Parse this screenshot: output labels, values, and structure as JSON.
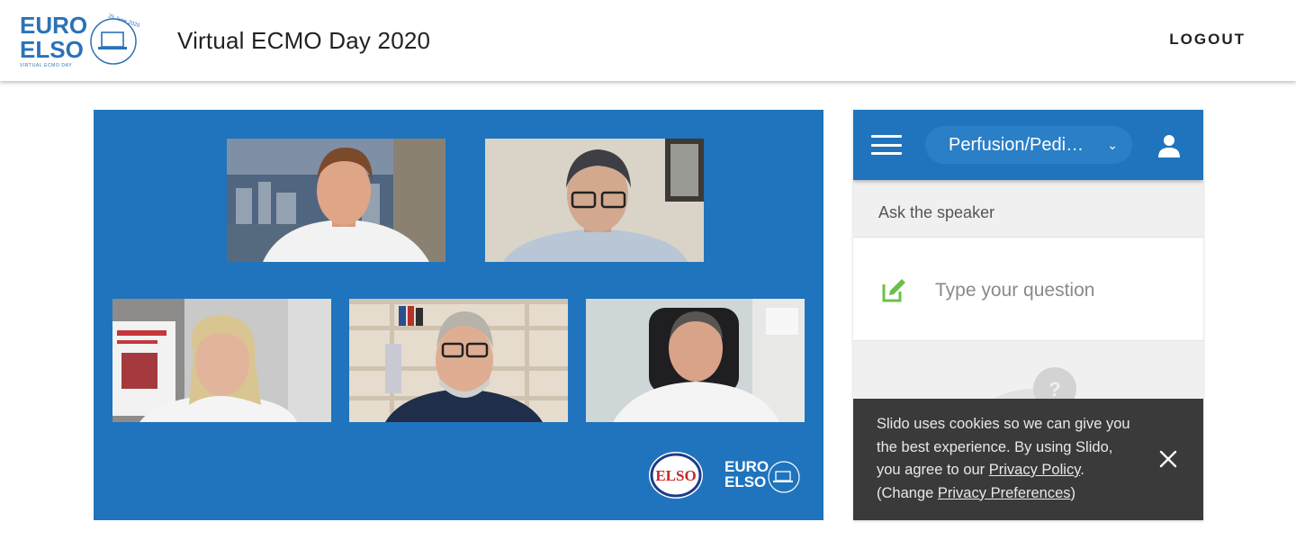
{
  "header": {
    "logo_text_top": "EURO",
    "logo_text_bottom": "ELSO",
    "logo_date": "25 June 2020",
    "logo_sub": "VIRTUAL ECMO DAY",
    "title": "Virtual ECMO Day 2020",
    "logout_label": "LOGOUT"
  },
  "stage": {
    "background": "#1f74bd",
    "participants": [
      {
        "name": "participant-1",
        "shirt": "#f2f2f2",
        "bg": "#5d6f86"
      },
      {
        "name": "participant-2",
        "shirt": "#b9c6d6",
        "bg": "#d9d3c8"
      },
      {
        "name": "participant-3",
        "shirt": "#f4f4f4",
        "bg": "#c9c9c9"
      },
      {
        "name": "participant-4",
        "shirt": "#1f2e4a",
        "bg": "#e6dccd"
      },
      {
        "name": "participant-5",
        "shirt": "#f4f4f4",
        "bg": "#cfd6d8"
      }
    ],
    "footer_logo_1": "ELSO",
    "footer_logo_2_top": "EURO",
    "footer_logo_2_bottom": "ELSO"
  },
  "slido": {
    "room_label": "Perfusion/Pedi…",
    "ask_label": "Ask the speaker",
    "question_placeholder": "Type your question",
    "cookie": {
      "text_1": "Slido uses cookies so we can give you the best experience. By using Slido, you agree to our ",
      "privacy_policy_link": "Privacy Policy",
      "text_2": ". (Change ",
      "privacy_prefs_link": "Privacy Preferences",
      "text_3": ")"
    },
    "colors": {
      "header": "#1f74bd",
      "accent": "#6cc04a"
    }
  }
}
